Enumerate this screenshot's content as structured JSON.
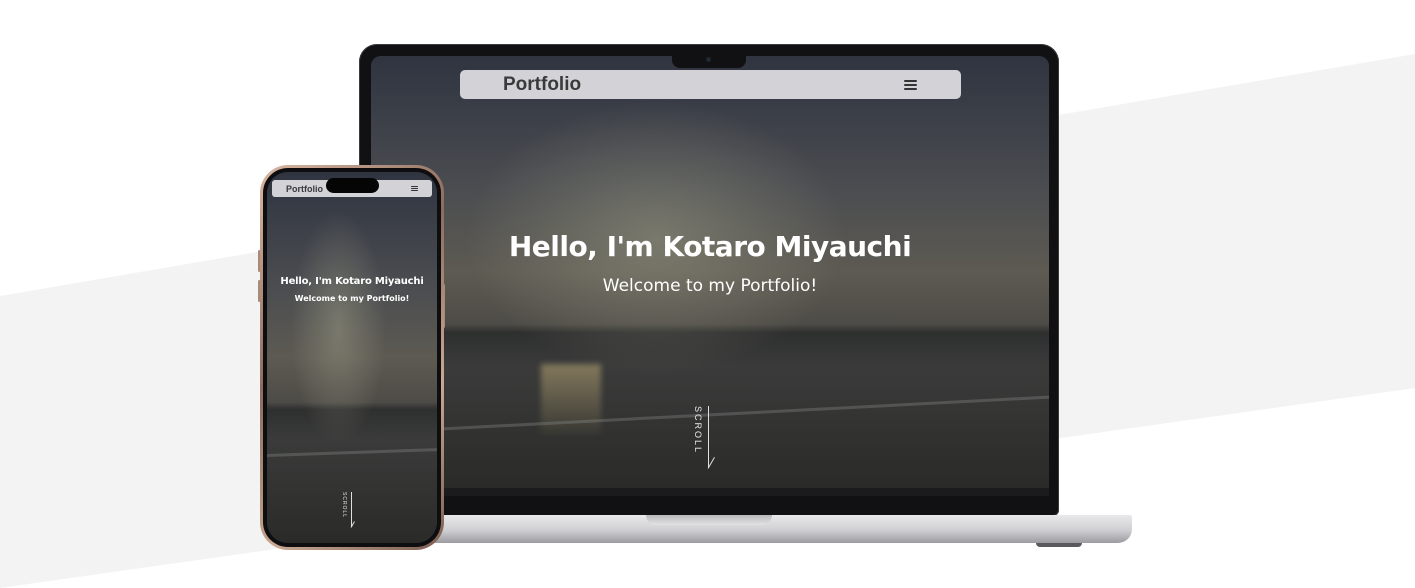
{
  "laptop_site": {
    "brand": "Portfolio",
    "menu_icon": "hamburger-menu-icon",
    "hero_title": "Hello, I'm Kotaro Miyauchi",
    "hero_subtitle": "Welcome to my Portfolio!",
    "scroll_label": "SCROLL"
  },
  "phone_site": {
    "brand": "Portfolio",
    "menu_icon": "hamburger-menu-icon",
    "hero_title": "Hello, I'm Kotaro Miyauchi",
    "hero_subtitle": "Welcome to my Portfolio!",
    "scroll_label": "SCROLL"
  },
  "colors": {
    "background": "#ffffff",
    "band": "#f3f3f3",
    "nav_bar": "#e1e1e4",
    "hero_text": "#ffffff"
  }
}
